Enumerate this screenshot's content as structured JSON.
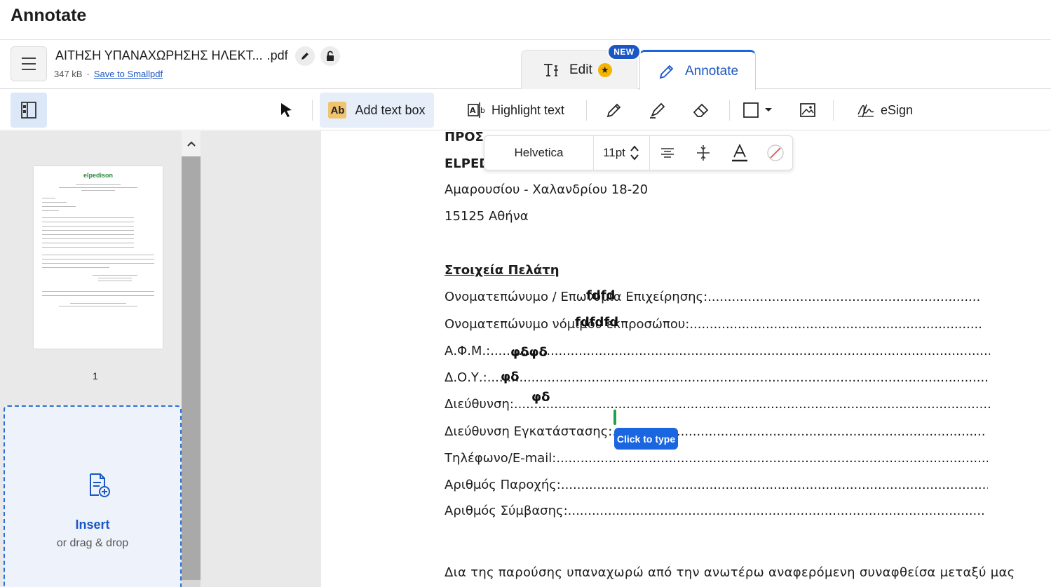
{
  "header": {
    "title": "Annotate"
  },
  "file": {
    "name": "ΑΙΤΗΣΗ ΥΠΑΝΑΧΩΡΗΣΗΣ ΗΛΕΚΤ...",
    "extension": ".pdf",
    "size": "347 kB",
    "separator": "·",
    "save_link": "Save to Smallpdf"
  },
  "mode_tabs": {
    "edit": "Edit",
    "annotate": "Annotate",
    "new_badge": "NEW"
  },
  "toolbar": {
    "add_text_box": "Add text box",
    "add_text_box_icon_text": "Ab",
    "highlight_text": "Highlight text",
    "esign": "eSign"
  },
  "format_bar": {
    "font": "Helvetica",
    "size": "11pt"
  },
  "sidebar": {
    "thumbnail_logo": "elpedison",
    "page_number": "1",
    "insert_title": "Insert",
    "insert_sub": "or drag & drop"
  },
  "document": {
    "lines": {
      "pros": "ΠΡΟΣ",
      "elped": "ELPED",
      "address": "Αμαρουσίου - Χαλανδρίου 18-20",
      "postal": "15125 Αθήνα",
      "section": "Στοιχεία Πελάτη",
      "f1": "Ονοματεπώνυμο / Επωνυμία Επιχείρησης:.........................................................................................",
      "f2": "Ονοματεπώνυμο νόμιμου εκπροσώπου:.............................................................................................",
      "f3": "Α.Φ.Μ.:.....................................................................................................................................................",
      "f4": "Δ.Ο.Υ.:.....................................................................................................................................................",
      "f5": "Διεύθυνση:...............................................................................................................................................",
      "f6": "Διεύθυνση Εγκατάστασης:.................................................................................................................",
      "f7": "Τηλέφωνο/E-mail:.......................................................................................................................................",
      "f8": "Αριθμός Παροχής:......................................................................................................................................",
      "f9": "Αριθμός Σύμβασης:...................................................................................................................................",
      "para": "Δια της παρούσης υπαναχωρώ από την ανωτέρω αναφερόμενη συναφθείσα μεταξύ μας"
    },
    "entries": {
      "e1": "fdfd",
      "e2": "fdfdfd",
      "e3": "φδφδ",
      "e4": "φδ",
      "e5": "φδ"
    },
    "tooltip": "Click to type"
  }
}
